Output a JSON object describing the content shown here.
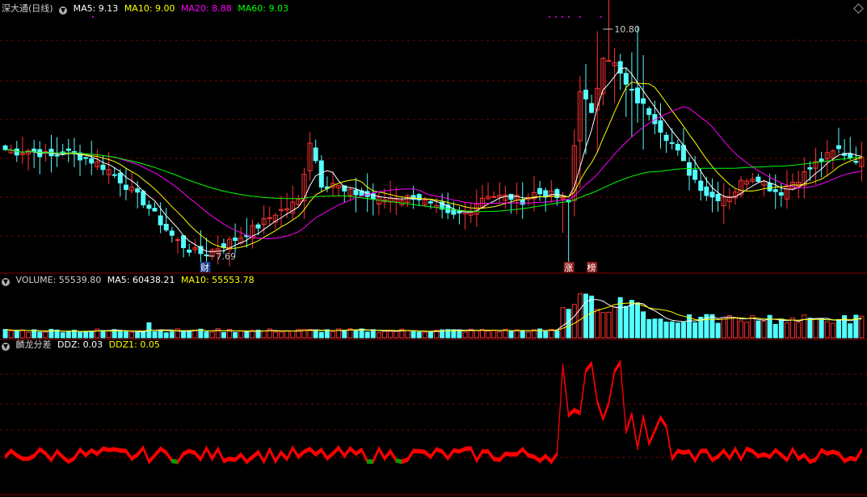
{
  "header": {
    "stock_title": "深大通(日线)",
    "ma5_label": "MA5: 9.13",
    "ma10_label": "MA10: 9.00",
    "ma20_label": "MA20: 8.88",
    "ma60_label": "MA60: 9.03"
  },
  "volume_header": {
    "title_label": "VOLUME: 55539.80",
    "ma5_label": "MA5: 60438.21",
    "ma10_label": "MA10: 55553.78"
  },
  "indicator_header": {
    "name": "麟龙分差",
    "ddz_label": "DDZ: 0.03",
    "ddz1_label": "DDZ1: 0.05"
  },
  "markers": {
    "high_label": "10.80",
    "low_label": "7.69",
    "cai_label": "财",
    "zhang_label": "涨",
    "bang_label": "榜"
  },
  "colors": {
    "up": "#ff3232",
    "down": "#54ffff",
    "ma5": "#ffffff",
    "ma10": "#ffff00",
    "ma20": "#ff00ff",
    "ma60": "#00ff00",
    "grid": "#7a0000",
    "indicator_pos": "#ff0000",
    "indicator_neg": "#00a000"
  },
  "chart_data": {
    "type": "candlestick",
    "price_range": [
      7.5,
      11.0
    ],
    "high": 10.8,
    "low": 7.69,
    "closes": [
      9.15,
      9.12,
      9.14,
      9.1,
      9.05,
      9.12,
      9.08,
      9.02,
      8.95,
      8.85,
      8.7,
      8.55,
      8.4,
      8.2,
      8.0,
      7.85,
      7.75,
      7.72,
      7.8,
      7.88,
      7.95,
      8.05,
      8.15,
      8.28,
      8.35,
      8.45,
      9.3,
      8.65,
      8.7,
      8.55,
      8.55,
      8.5,
      8.45,
      8.5,
      8.48,
      8.52,
      8.4,
      8.3,
      8.22,
      8.28,
      8.4,
      8.55,
      8.5,
      8.5,
      8.45,
      8.55,
      8.55,
      8.5,
      8.4,
      10.0,
      9.6,
      10.5,
      10.3,
      10.0,
      9.8,
      9.65,
      9.4,
      9.2,
      8.9,
      8.7,
      8.5,
      8.5,
      8.55,
      8.75,
      8.8,
      8.65,
      8.55,
      8.7,
      8.8,
      8.95,
      9.05,
      9.15,
      9.05,
      9.0
    ],
    "volume_range": [
      0,
      300000
    ],
    "ddz_range": [
      -0.3,
      0.9
    ]
  }
}
